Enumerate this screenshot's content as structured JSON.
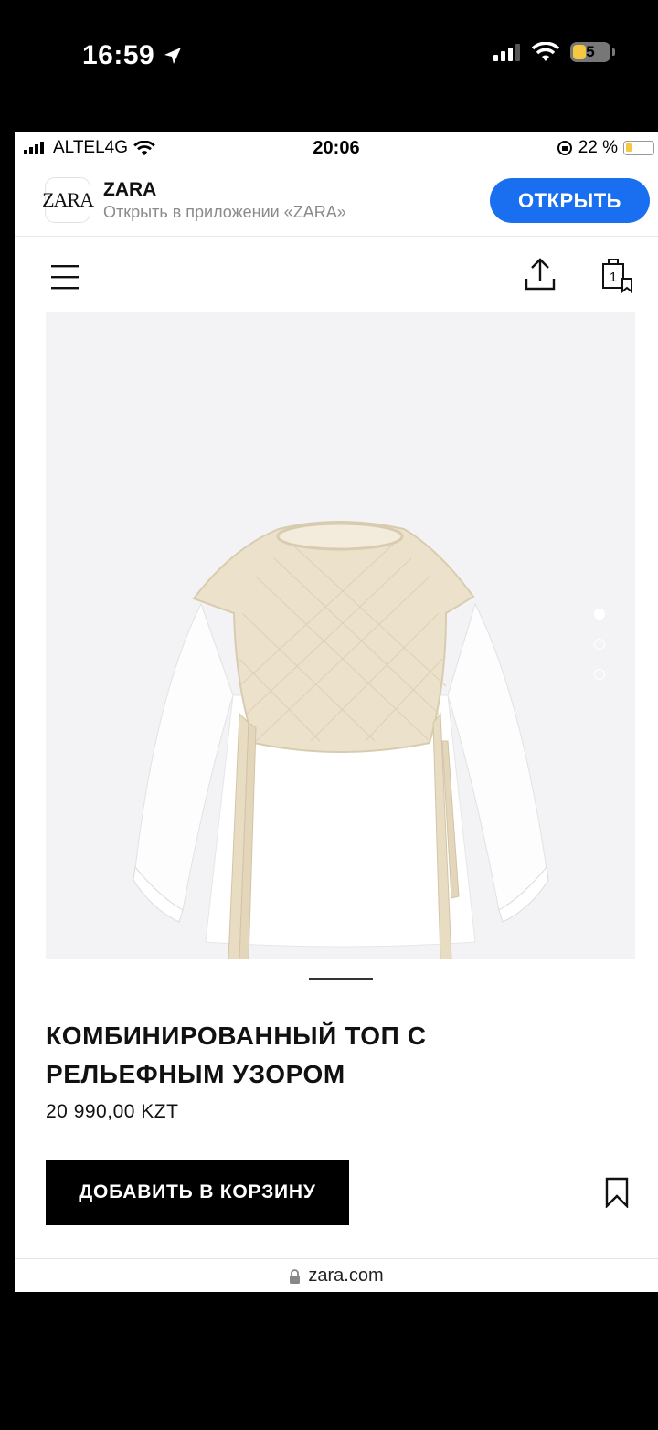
{
  "outer_status": {
    "time": "16:59",
    "battery": "5"
  },
  "inner_status": {
    "carrier": "ALTEL4G",
    "time": "20:06",
    "battery_percent": "22 %"
  },
  "app_banner": {
    "icon_text": "ZARA",
    "title": "ZARA",
    "subtitle": "Открыть в приложении «ZARA»",
    "open_label": "ОТКРЫТЬ"
  },
  "product": {
    "name": "КОМБИНИРОВАННЫЙ ТОП С РЕЛЬЕФНЫМ УЗОРОМ",
    "price": "20 990,00 KZT",
    "add_to_cart_label": "ДОБАВИТЬ В КОРЗИНУ",
    "image_count": 3,
    "active_image": 1
  },
  "cart": {
    "count": "1"
  },
  "address": {
    "url": "zara.com"
  },
  "colors": {
    "accent": "#1a6ff0",
    "cta": "#000000",
    "sweater": "#ece2cc"
  },
  "icons": [
    "location-arrow-icon",
    "signal-icon",
    "wifi-icon",
    "battery-icon",
    "orientation-lock-icon",
    "menu-icon",
    "share-icon",
    "shopping-bag-icon",
    "bookmark-icon",
    "lock-icon"
  ]
}
